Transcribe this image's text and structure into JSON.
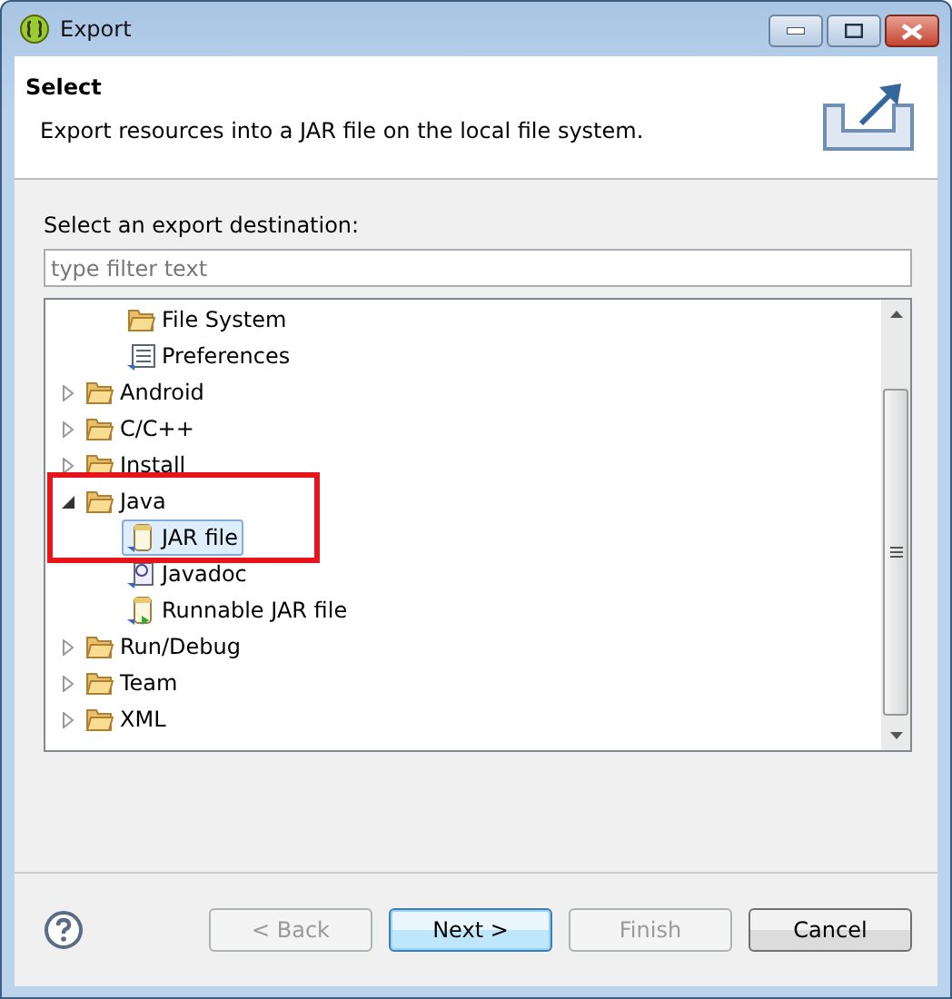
{
  "window": {
    "title": "Export"
  },
  "header": {
    "title": "Select",
    "description": "Export resources into a JAR file on the local file system."
  },
  "destination": {
    "label": "Select an export destination:",
    "filter": {
      "placeholder": "type filter text"
    }
  },
  "tree": [
    {
      "children": [
        {
          "label": "File System",
          "kind": "folder",
          "selected": false
        },
        {
          "label": "Preferences",
          "kind": "preferences",
          "selected": false
        }
      ]
    },
    {
      "label": "Android",
      "kind": "folder",
      "expanded": false,
      "selected": false
    },
    {
      "label": "C/C++",
      "kind": "folder",
      "expanded": false,
      "selected": false
    },
    {
      "label": "Install",
      "kind": "folder",
      "expanded": false,
      "selected": false
    },
    {
      "label": "Java",
      "kind": "folder",
      "expanded": true,
      "selected": false,
      "children": [
        {
          "label": "JAR file",
          "kind": "jar",
          "selected": true
        },
        {
          "label": "Javadoc",
          "kind": "javadoc",
          "selected": false
        },
        {
          "label": "Runnable JAR file",
          "kind": "runnable-jar",
          "selected": false
        }
      ]
    },
    {
      "label": "Run/Debug",
      "kind": "folder",
      "expanded": false,
      "selected": false
    },
    {
      "label": "Team",
      "kind": "folder",
      "expanded": false,
      "selected": false
    },
    {
      "label": "XML",
      "kind": "folder",
      "expanded": false,
      "selected": false
    }
  ],
  "buttons": [
    {
      "label": "< Back",
      "disabled": true,
      "default": false
    },
    {
      "label": "Next >",
      "disabled": false,
      "default": true
    },
    {
      "label": "Finish",
      "disabled": true,
      "default": false
    },
    {
      "label": "Cancel",
      "disabled": false,
      "default": false
    }
  ]
}
